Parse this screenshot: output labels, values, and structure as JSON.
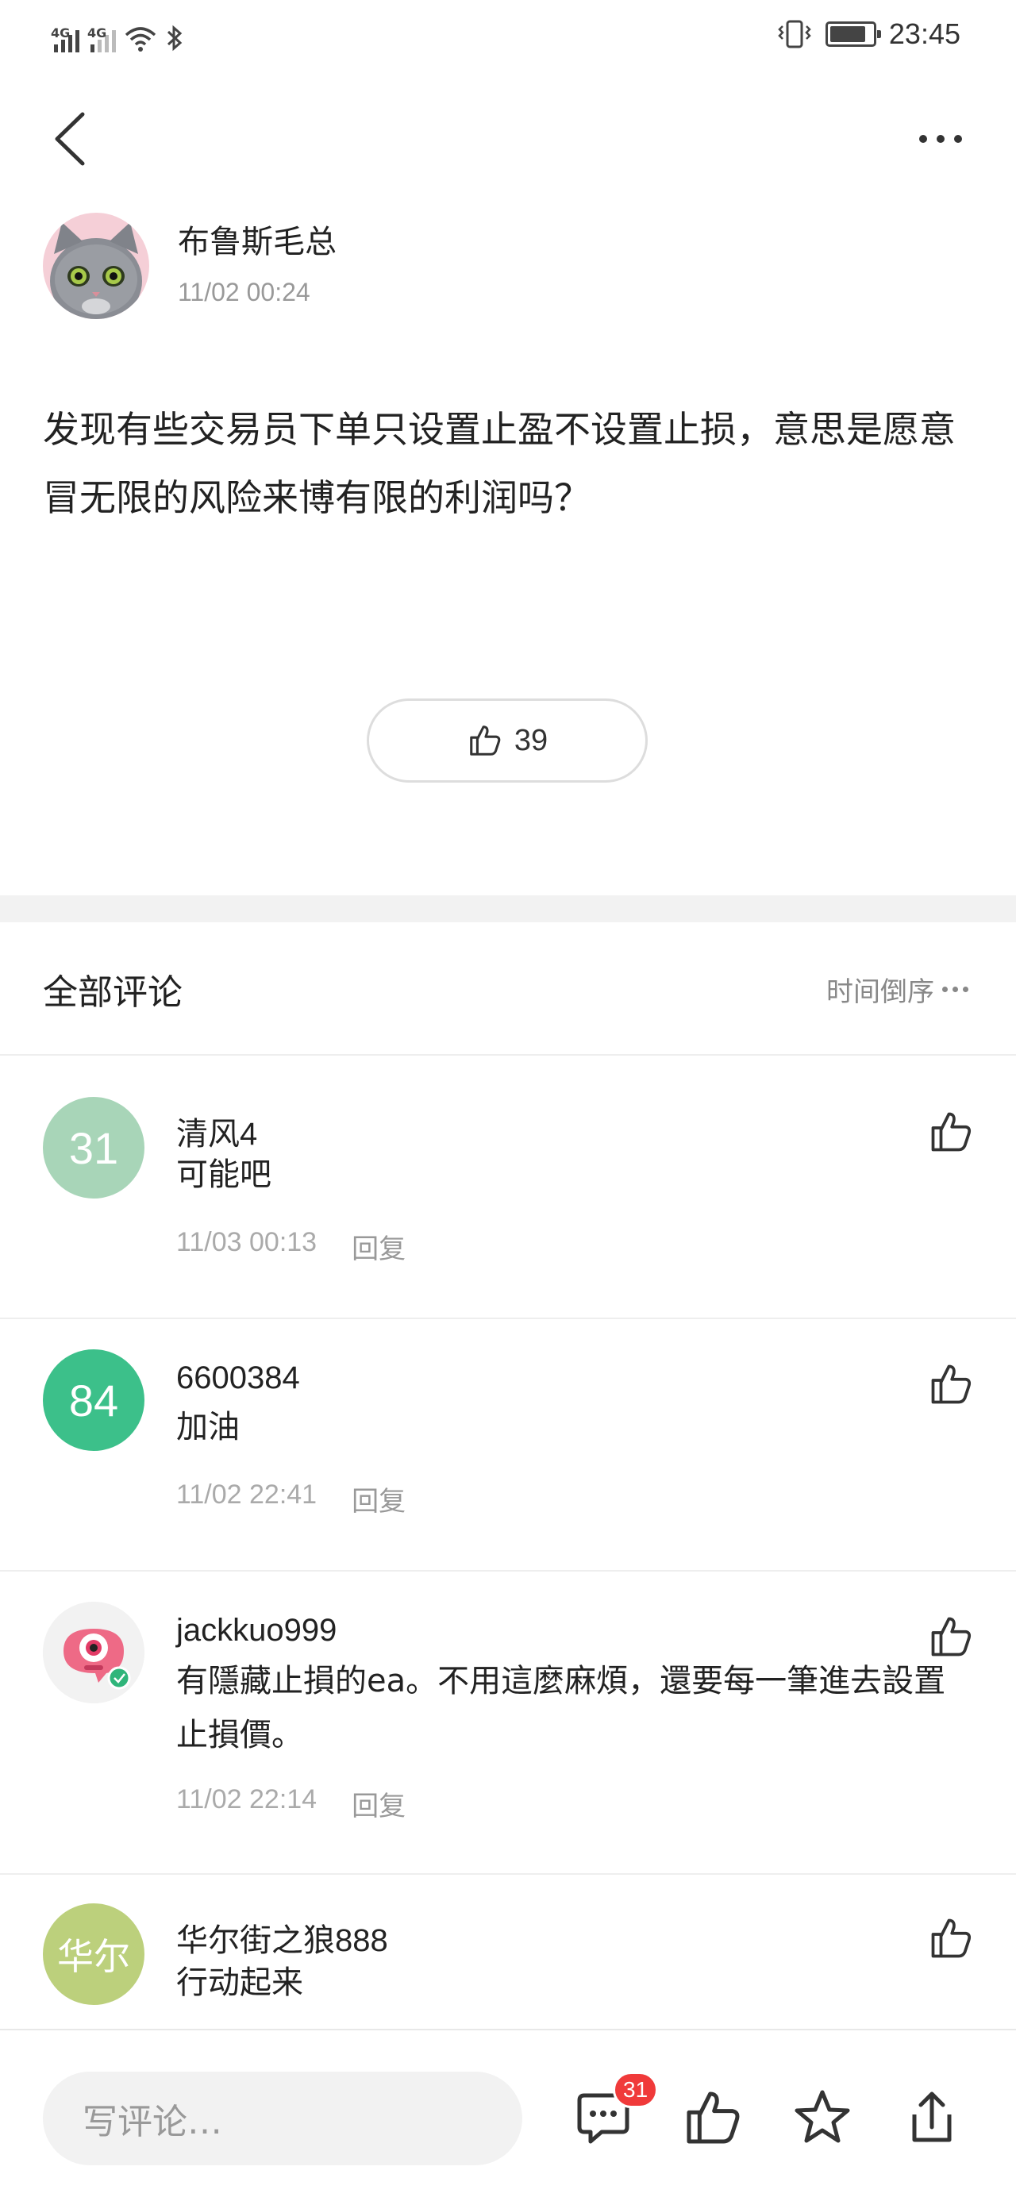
{
  "status_bar": {
    "network1": "4G",
    "network2": "4G",
    "time": "23:45"
  },
  "post": {
    "author": "布鲁斯毛总",
    "time": "11/02 00:24",
    "body": "发现有些交易员下单只设置止盈不设置止损，意思是愿意冒无限的风险来博有限的利润吗？",
    "like_count": "39"
  },
  "comments_section": {
    "title": "全部评论",
    "sort_label": "时间倒序"
  },
  "comments": [
    {
      "avatar_text": "31",
      "avatar_color": "#a8d5b8",
      "name": "清风4",
      "text": "可能吧",
      "time": "11/03 00:13",
      "reply_label": "回复"
    },
    {
      "avatar_text": "84",
      "avatar_color": "#3cc08a",
      "name": "6600384",
      "text": "加油",
      "time": "11/02 22:41",
      "reply_label": "回复"
    },
    {
      "avatar_text": "",
      "avatar_color": "#f2f2f2",
      "name": "jackkuo999",
      "text": "有隱藏止損的ea。不用這麼麻煩，還要每一筆進去設置止損價。",
      "time": "11/02 22:14",
      "reply_label": "回复"
    },
    {
      "avatar_text": "华尔",
      "avatar_color": "#bcd07c",
      "name": "华尔街之狼888",
      "text": "行动起来",
      "time": "",
      "reply_label": ""
    }
  ],
  "bottom_bar": {
    "input_placeholder": "写评论…",
    "comment_badge": "31"
  },
  "icons": [
    "back-arrow-icon",
    "more-icon",
    "thumbs-up-icon",
    "comment-icon",
    "star-icon",
    "share-icon",
    "wifi-icon",
    "bluetooth-icon",
    "vibrate-icon",
    "battery-icon"
  ]
}
